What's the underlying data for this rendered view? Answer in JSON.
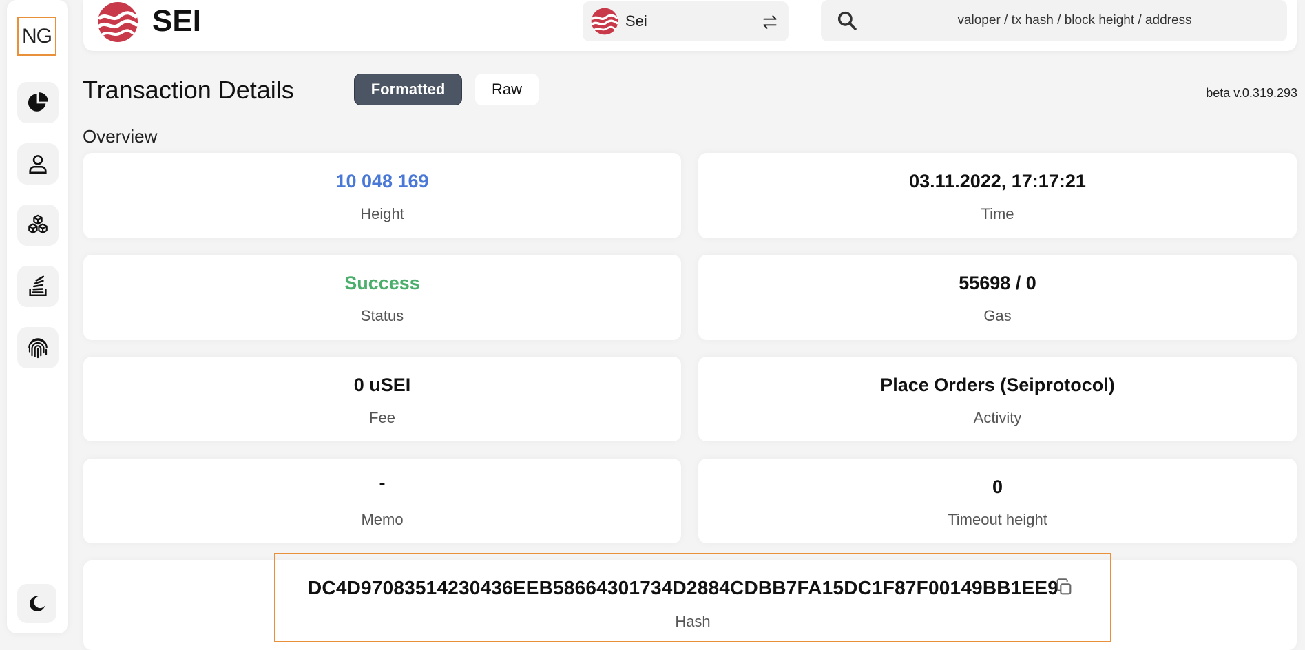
{
  "sidebar": {
    "logo_text": "NG",
    "items": [
      {
        "icon": "pie-chart-icon"
      },
      {
        "icon": "user-icon"
      },
      {
        "icon": "blocks-icon"
      },
      {
        "icon": "stack-icon"
      },
      {
        "icon": "fingerprint-icon"
      }
    ],
    "theme_icon": "moon-icon"
  },
  "header": {
    "brand_name": "SEI",
    "network": {
      "name": "Sei"
    },
    "search": {
      "placeholder": "valoper / tx hash / block height / address"
    }
  },
  "page": {
    "title": "Transaction Details",
    "tabs": [
      "Formatted",
      "Raw"
    ],
    "active_tab": "Formatted",
    "version": "beta v.0.319.293",
    "section_label": "Overview"
  },
  "overview": {
    "height": {
      "value": "10 048 169",
      "label": "Height"
    },
    "time": {
      "value": "03.11.2022, 17:17:21",
      "label": "Time"
    },
    "status": {
      "value": "Success",
      "label": "Status"
    },
    "gas": {
      "value": "55698 / 0",
      "label": "Gas"
    },
    "fee": {
      "value": "0 uSEI",
      "label": "Fee"
    },
    "activity": {
      "value": "Place Orders (Seiprotocol)",
      "label": "Activity"
    },
    "memo": {
      "value": "-",
      "label": "Memo"
    },
    "timeout_height": {
      "value": "0",
      "label": "Timeout height"
    },
    "hash": {
      "value": "DC4D97083514230436EEB58664301734D2884CDBB7FA15DC1F87F00149BB1EE9",
      "label": "Hash"
    }
  },
  "colors": {
    "accent_blue": "#4a78d6",
    "success_green": "#4cae6c",
    "highlight_orange": "#e8913a",
    "brand_red": "#c8394a"
  }
}
